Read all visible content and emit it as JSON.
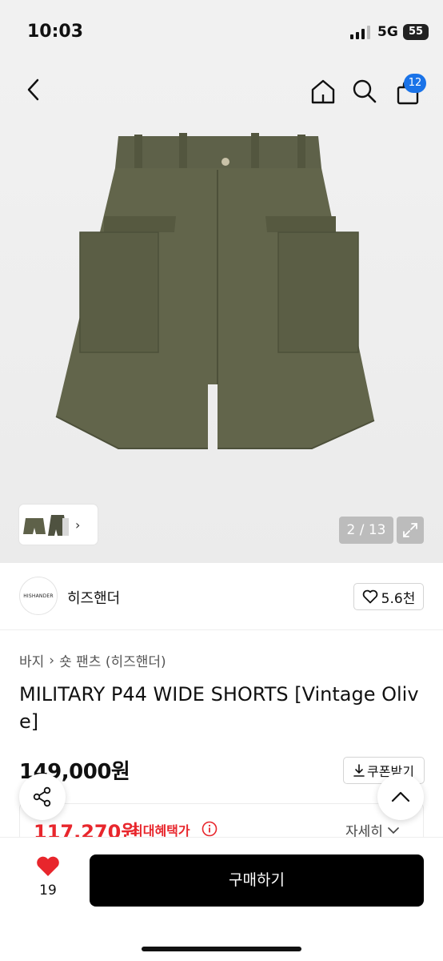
{
  "status_bar": {
    "time": "10:03",
    "network": "5G",
    "battery": "55"
  },
  "nav": {
    "bag_count": "12"
  },
  "gallery": {
    "counter": "2 / 13"
  },
  "brand": {
    "logo_text": "HISHANDER",
    "name": "히즈핸더",
    "likes": "5.6천"
  },
  "breadcrumb": {
    "category": "바지",
    "subcategory": "숏 팬츠 (히즈핸더)"
  },
  "product": {
    "title": "MILITARY P44 WIDE SHORTS [Vintage Olive]"
  },
  "price": {
    "original": "149,000원",
    "coupon_label": "쿠폰받기",
    "sale": "117,270원",
    "sale_label": "최대혜택가",
    "detail_label": "자세히"
  },
  "bottom": {
    "wish_count": "19",
    "buy_label": "구매하기"
  },
  "colors": {
    "accent_red": "#e8262c",
    "badge_blue": "#1a73e8",
    "product_olive": "#5e6149"
  }
}
